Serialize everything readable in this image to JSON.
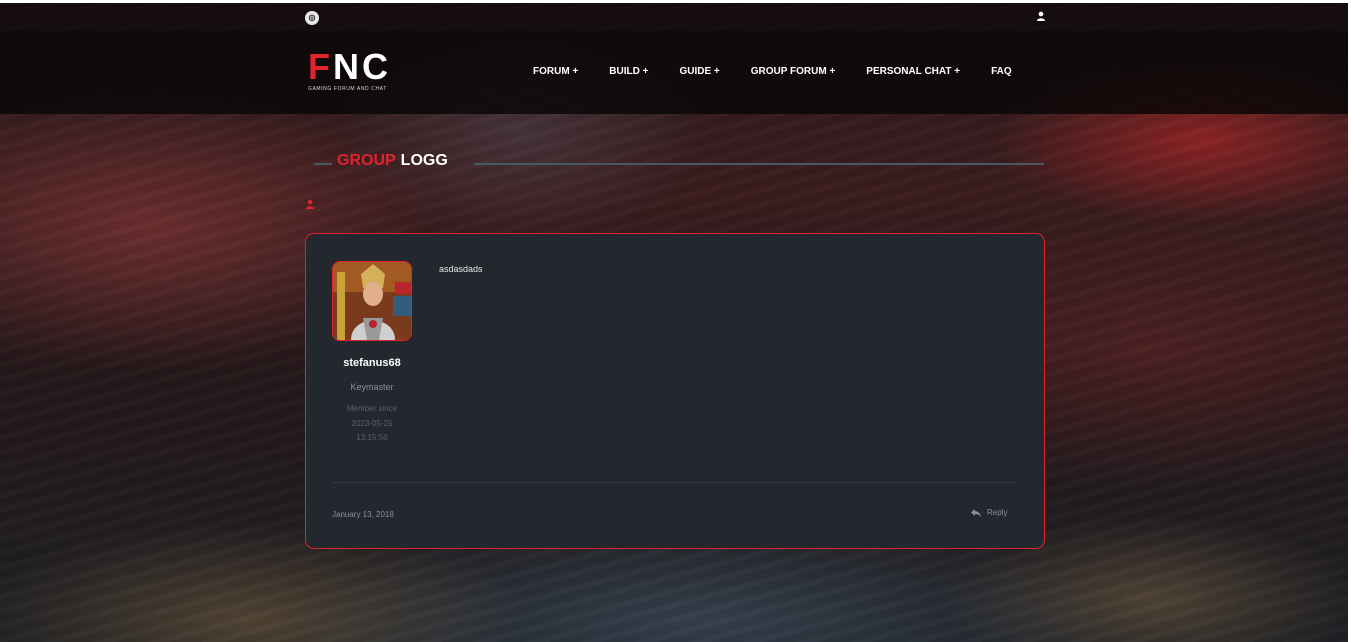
{
  "site": {
    "logo_text": "FNC",
    "logo_first_letter": "F",
    "logo_rest": "NC",
    "tagline": "GAMING FORUM AND CHAT"
  },
  "topbar": {
    "left_icon": "instagram-icon",
    "right_icon": "user-icon"
  },
  "nav": {
    "items": [
      {
        "label": "FORUM +"
      },
      {
        "label": "BUILD +"
      },
      {
        "label": "GUIDE +"
      },
      {
        "label": "GROUP FORUM +"
      },
      {
        "label": "PERSONAL CHAT +"
      },
      {
        "label": "FAQ"
      }
    ]
  },
  "page": {
    "title_accent": "GROUP",
    "title_rest": "LOGG"
  },
  "post": {
    "content": "asdasdads",
    "author": {
      "name": "stefanus68",
      "role": "Keymaster",
      "member_since_label": "Member since",
      "member_since_date": "2023-05-25",
      "member_since_time": "13:15:56"
    },
    "date": "January 13, 2018",
    "reply_label": "Reply"
  },
  "colors": {
    "accent": "#e0232e",
    "card_bg": "#23272e",
    "header_bg": "#080606"
  }
}
